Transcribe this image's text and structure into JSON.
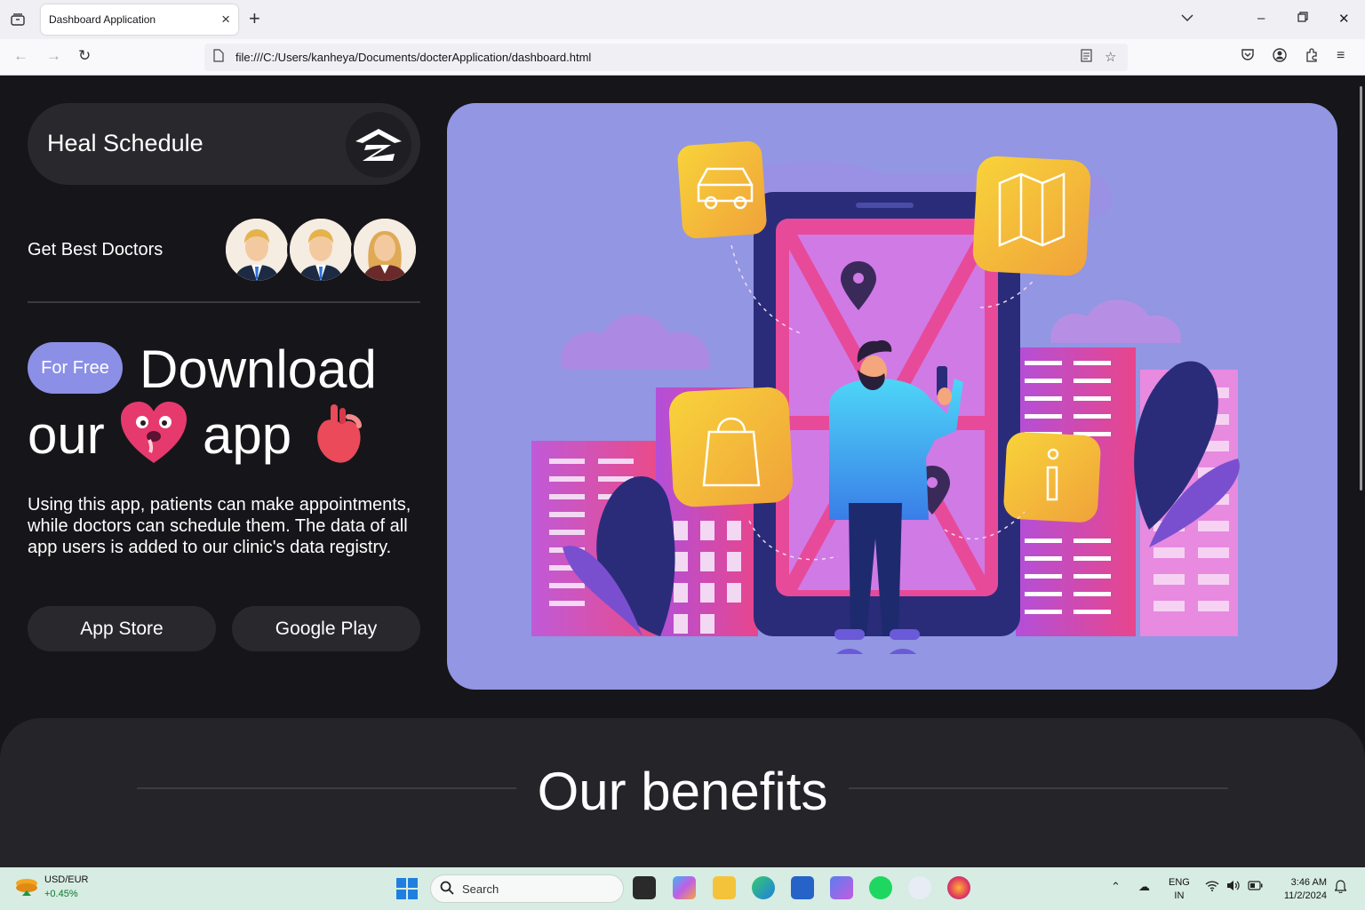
{
  "browser": {
    "tab_title": "Dashboard Application",
    "url": "file:///C:/Users/kanheya/Documents/docterApplication/dashboard.html"
  },
  "page": {
    "brand": "Heal Schedule",
    "best_doctors": "Get Best Doctors",
    "pill": "For Free",
    "headline_1": "Download",
    "headline_2a": "our",
    "headline_2b": "app",
    "description": "Using this app, patients can make appointments, while doctors can schedule them. The data of all app users is added to our clinic's data registry.",
    "app_store": "App Store",
    "google_play": "Google Play",
    "benefits_title": "Our benefits"
  },
  "taskbar": {
    "ticker_name": "USD/EUR",
    "ticker_value": "+0.45%",
    "search_placeholder": "Search",
    "lang_1": "ENG",
    "lang_2": "IN",
    "time": "3:46 AM",
    "date": "11/2/2024"
  },
  "colors": {
    "page_bg": "#16161a",
    "pill": "#8b8fe6",
    "hero_bg": "#9296e3",
    "card": "#28282d"
  }
}
